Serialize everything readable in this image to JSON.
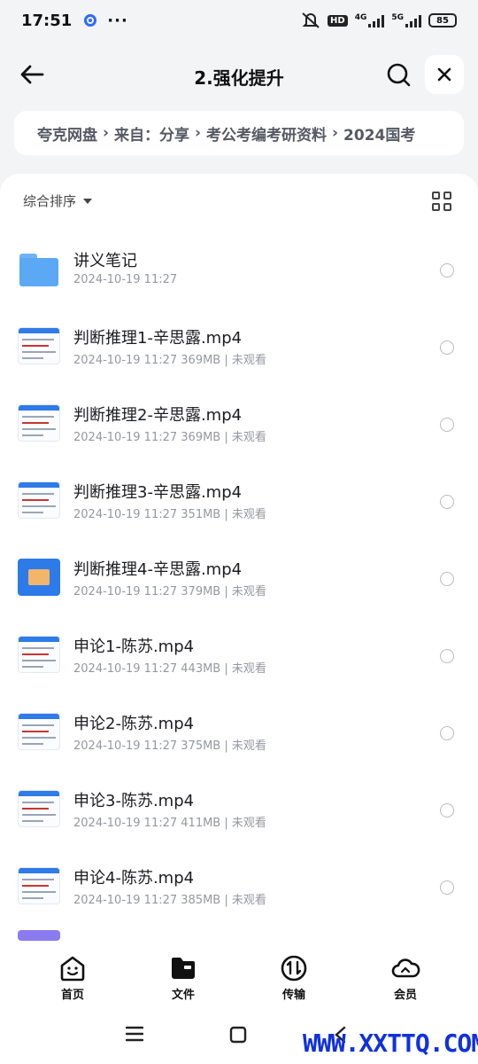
{
  "status": {
    "time": "17:51",
    "more": "···",
    "hd": "HD",
    "net1": "4G",
    "net2": "5G",
    "battery": "85"
  },
  "header": {
    "title": "2.强化提升"
  },
  "breadcrumb": {
    "items": [
      "夸克网盘",
      "来自：分享",
      "考公考编考研资料",
      "2024国考"
    ],
    "separator": "›"
  },
  "list": {
    "sort_label": "综合排序",
    "items": [
      {
        "name": "讲义笔记",
        "meta": "2024-10-19 11:27",
        "type": "folder"
      },
      {
        "name": "判断推理1-辛思露.mp4",
        "meta": "2024-10-19 11:27  369MB | 未观看",
        "type": "video"
      },
      {
        "name": "判断推理2-辛思露.mp4",
        "meta": "2024-10-19 11:27  369MB | 未观看",
        "type": "video"
      },
      {
        "name": "判断推理3-辛思露.mp4",
        "meta": "2024-10-19 11:27  351MB | 未观看",
        "type": "video"
      },
      {
        "name": "判断推理4-辛思露.mp4",
        "meta": "2024-10-19 11:27  379MB | 未观看",
        "type": "video-blue"
      },
      {
        "name": "申论1-陈苏.mp4",
        "meta": "2024-10-19 11:27  443MB | 未观看",
        "type": "video"
      },
      {
        "name": "申论2-陈苏.mp4",
        "meta": "2024-10-19 11:27  375MB | 未观看",
        "type": "video"
      },
      {
        "name": "申论3-陈苏.mp4",
        "meta": "2024-10-19 11:27  411MB | 未观看",
        "type": "video"
      },
      {
        "name": "申论4-陈苏.mp4",
        "meta": "2024-10-19 11:27  385MB | 未观看",
        "type": "video"
      }
    ]
  },
  "bottom_nav": {
    "items": [
      {
        "label": "首页",
        "icon": "home-smile-icon"
      },
      {
        "label": "文件",
        "icon": "folder-icon"
      },
      {
        "label": "传输",
        "icon": "transfer-icon"
      },
      {
        "label": "会员",
        "icon": "cloud-icon"
      }
    ]
  },
  "watermark": "WWW.XXTTQ.COM",
  "colors": {
    "background": "#f3f4f6",
    "accent": "#2d6bff"
  }
}
